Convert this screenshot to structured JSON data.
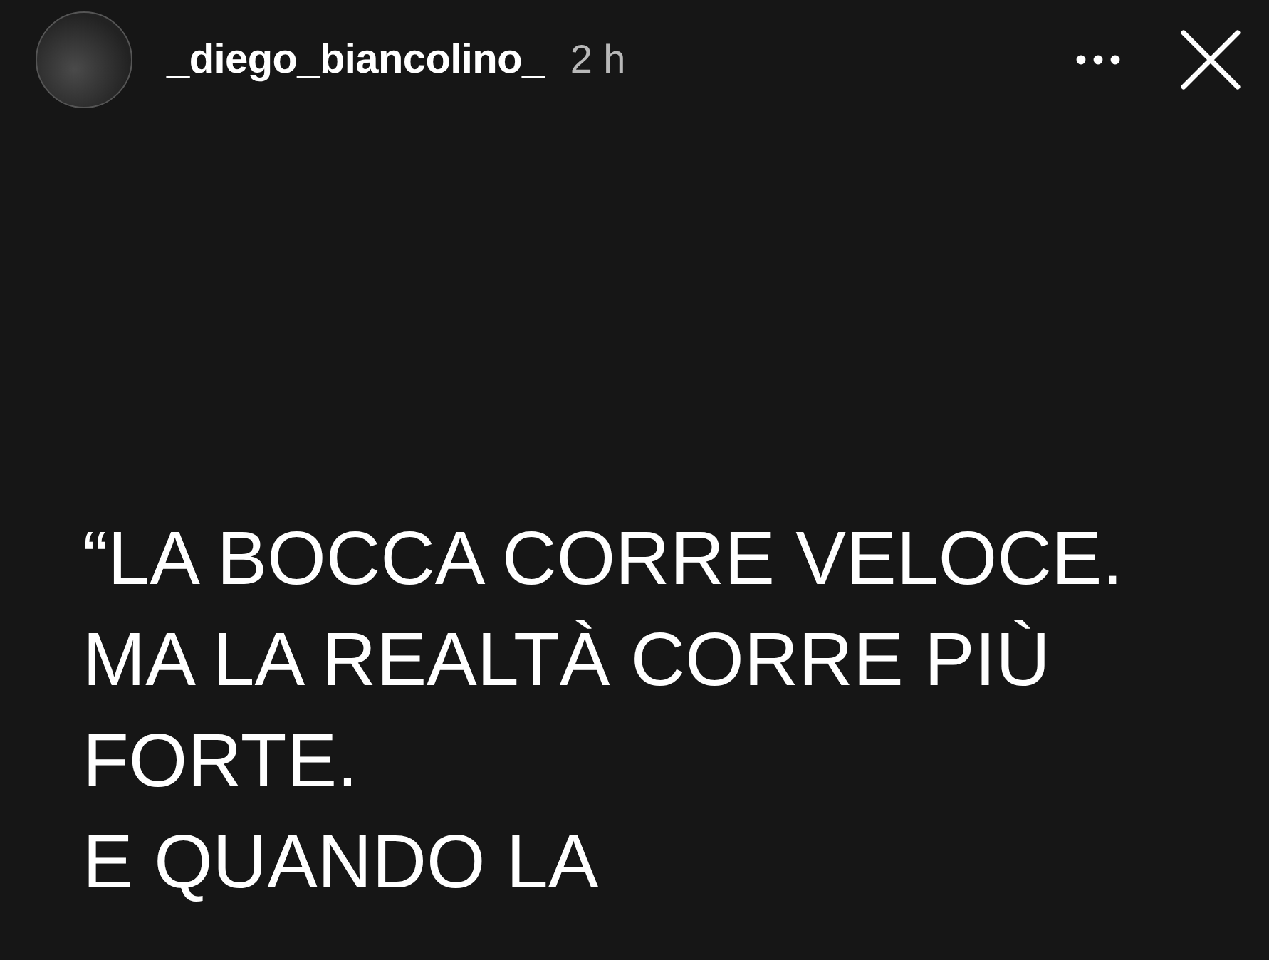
{
  "header": {
    "username": "_diego_biancolino_",
    "time": "2 h"
  },
  "story": {
    "lines": [
      "“LA BOCCA CORRE VELOCE.",
      "MA LA REALTÀ CORRE PIÙ",
      "FORTE.",
      "E QUANDO LA"
    ]
  }
}
